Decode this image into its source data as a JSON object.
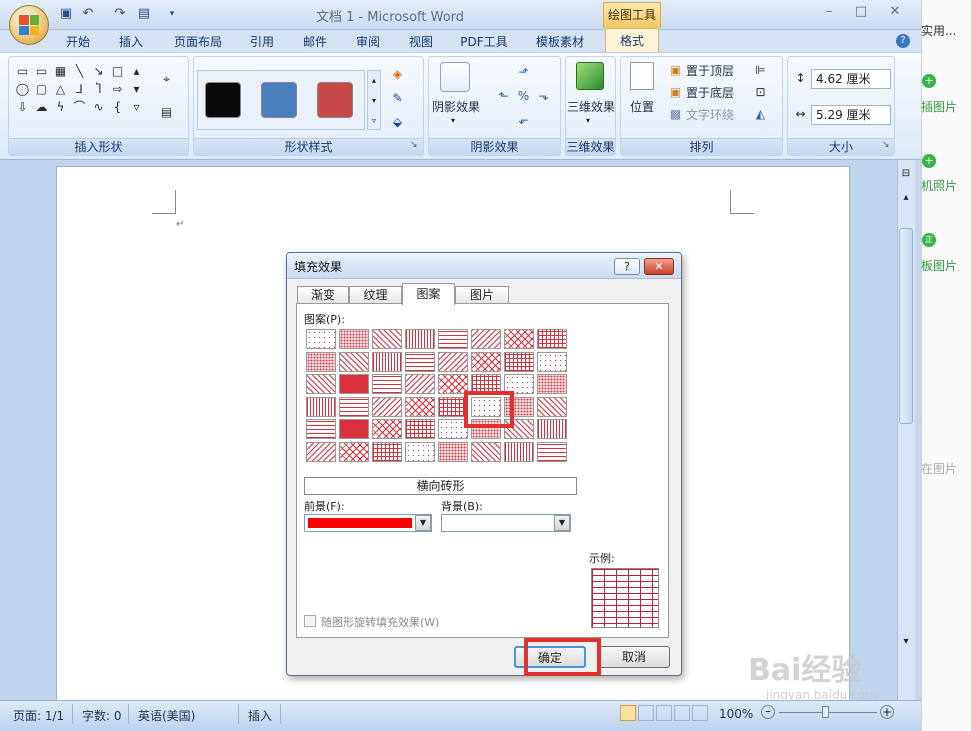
{
  "window": {
    "title": "文档 1 - Microsoft Word",
    "contextual_tools": "绘图工具"
  },
  "tabs": [
    "开始",
    "插入",
    "页面布局",
    "引用",
    "邮件",
    "审阅",
    "视图",
    "PDF工具",
    "模板素材",
    "格式"
  ],
  "ribbon": {
    "groups": {
      "insert_shapes": "插入形状",
      "shape_styles": "形状样式",
      "shadow_effects": "阴影效果",
      "three_d": "三维效果",
      "arrange": "排列",
      "size": "大小"
    },
    "shadow_effect_label": "阴影效果",
    "three_d_label": "三维效果",
    "position_label": "位置",
    "bring_to_front": "置于顶层",
    "send_to_back": "置于底层",
    "text_wrap": "文字环绕",
    "height_value": "4.62 厘米",
    "width_value": "5.29 厘米",
    "style_colors": [
      "#0a0a0a",
      "#4a7fbf",
      "#c74a48"
    ]
  },
  "side_panel": {
    "items": [
      "实用...",
      "插图片",
      "机照片",
      "板图片",
      "在图片"
    ]
  },
  "status_bar": {
    "page": "页面: 1/1",
    "words": "字数: 0",
    "language": "英语(美国)",
    "mode": "插入",
    "zoom": "100%"
  },
  "dialog": {
    "title": "填充效果",
    "help": "?",
    "close": "✕",
    "tabs": [
      "渐变",
      "纹理",
      "图案",
      "图片"
    ],
    "active_tab": "图案",
    "pattern_label": "图案(P):",
    "selected_pattern_name": "横向砖形",
    "foreground_label": "前景(F):",
    "background_label": "背景(B):",
    "foreground_color": "#ff0000",
    "sample_label": "示例:",
    "rotate_checkbox_label": "随图形旋转填充效果(W)",
    "rotate_checked": false,
    "ok": "确定",
    "cancel": "取消"
  },
  "watermark": {
    "brand": "Bai经验",
    "url": "jingyan.baidu.com"
  }
}
